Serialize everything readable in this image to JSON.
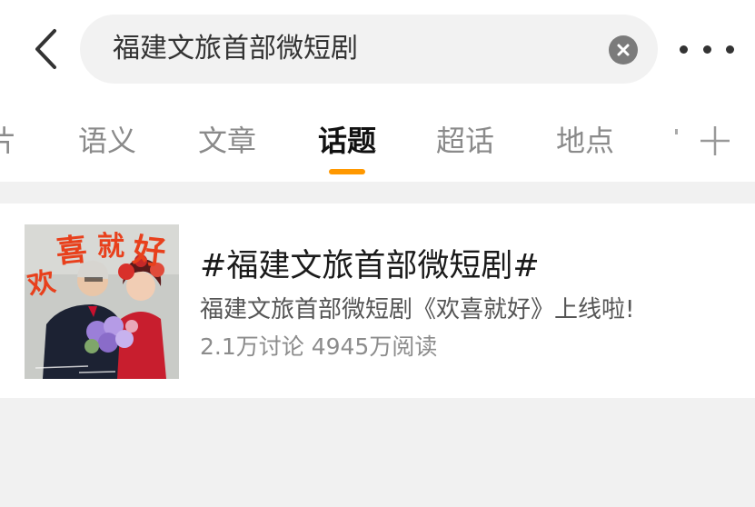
{
  "search": {
    "query": "福建文旅首部微短剧"
  },
  "tabs": {
    "partial": "片",
    "items": [
      {
        "label": "语义"
      },
      {
        "label": "文章"
      },
      {
        "label": "话题"
      },
      {
        "label": "超话"
      },
      {
        "label": "地点"
      }
    ],
    "active_index": 2
  },
  "icons": {
    "back": "chevron-left-icon",
    "clear": "close-circle-icon",
    "more": "more-horizontal-icon",
    "add": "plus-icon"
  },
  "colors": {
    "accent": "#ff9800",
    "poster_red": "#e8401c"
  },
  "topic": {
    "title": "#福建文旅首部微短剧#",
    "description": "福建文旅首部微短剧《欢喜就好》上线啦!",
    "stats": "2.1万讨论 4945万阅读",
    "thumbnail": {
      "poster_title": "欢喜就好"
    }
  }
}
